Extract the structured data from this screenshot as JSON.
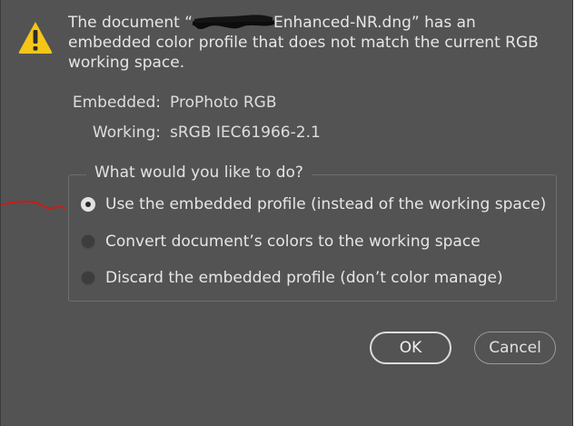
{
  "dialog": {
    "icon": "warning-icon",
    "message_prefix": "The document “",
    "message_suffix": "Enhanced-NR.dng” has an embedded color profile that does not match the current RGB working space.",
    "embedded_label": "Embedded:",
    "embedded_value": "ProPhoto RGB",
    "working_label": "Working:",
    "working_value": "sRGB IEC61966-2.1",
    "question": "What would you like to do?",
    "options": [
      {
        "label": "Use the embedded profile (instead of the working space)",
        "checked": true
      },
      {
        "label": "Convert document’s colors to the working space",
        "checked": false
      },
      {
        "label": "Discard the embedded profile (don’t color manage)",
        "checked": false
      }
    ],
    "ok_label": "OK",
    "cancel_label": "Cancel"
  },
  "colors": {
    "background": "#535353",
    "warning_yellow": "#f5c518",
    "annotation_red": "#d01818"
  }
}
